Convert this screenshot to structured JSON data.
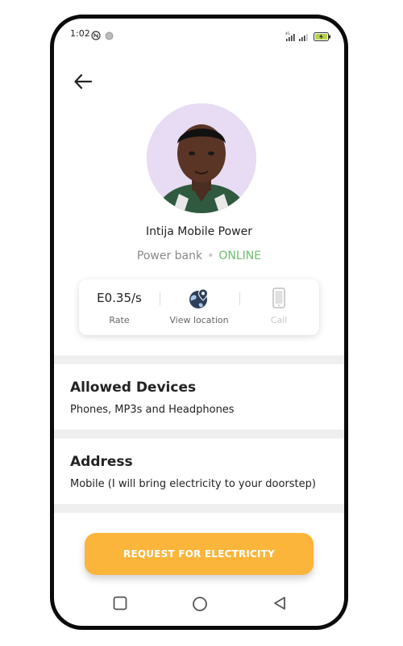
{
  "status_bar": {
    "time": "1:02",
    "nfc_icon": "nfc-icon",
    "network_label": "4G",
    "battery_icon": "battery-charging-icon"
  },
  "profile": {
    "name": "Intija Mobile Power",
    "category": "Power bank",
    "status": "ONLINE",
    "avatar_bg": "#e7dcf3"
  },
  "stats": {
    "rate_value": "E0.35/s",
    "rate_label": "Rate",
    "location_label": "View location",
    "call_label": "Call"
  },
  "sections": {
    "devices_title": "Allowed Devices",
    "devices_text": "Phones, MP3s and Headphones",
    "address_title": "Address",
    "address_text": "Mobile (I will bring electricity to your doorstep)"
  },
  "cta": {
    "label": "REQUEST FOR ELECTRICITY",
    "color": "#fbb53a"
  },
  "colors": {
    "online": "#6bbf6b",
    "accent": "#fbb53a"
  }
}
